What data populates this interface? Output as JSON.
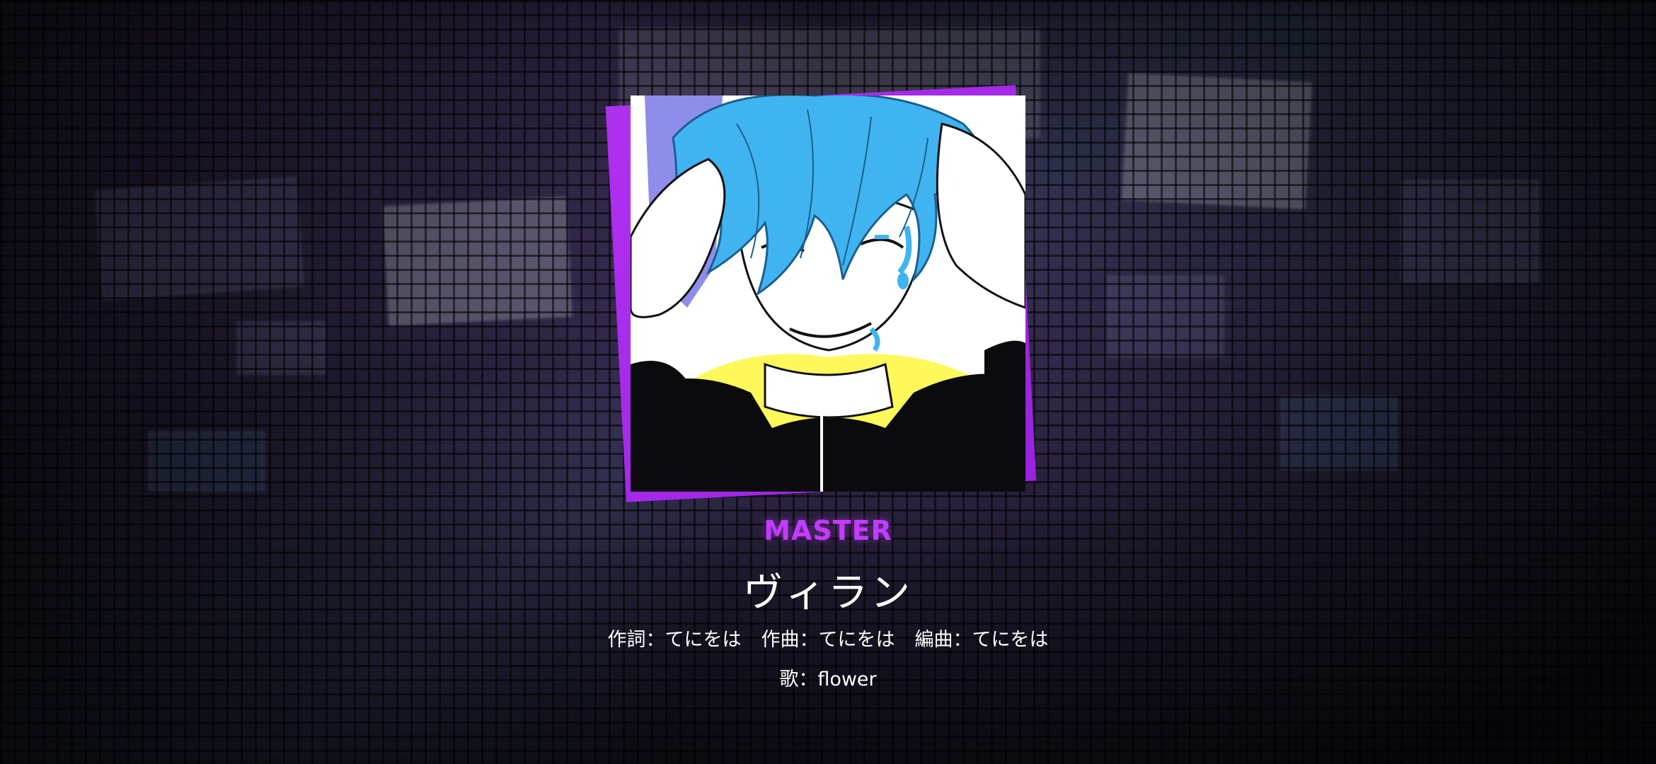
{
  "song": {
    "difficulty": "MASTER",
    "title": "ヴィラン",
    "lyrics": "作詞：てにをは",
    "composer": "作曲：てにをは",
    "arranger": "編曲：てにをは",
    "vocal": "歌：flower"
  },
  "jacket": {
    "description_icon": "album-jacket-art",
    "frame_color": "#b030f0"
  },
  "colors": {
    "difficulty_accent": "#c23bff",
    "text": "#ffffff",
    "hair": "#3fb4f0",
    "collar": "#fff85a"
  }
}
